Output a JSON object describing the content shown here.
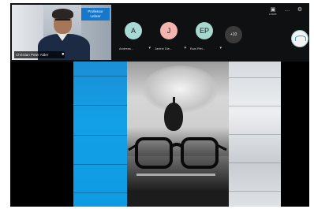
{
  "meeting": {
    "self_view": {
      "name_label": "Christian Peter Alder",
      "badge_line1": "Professor",
      "badge_line2": "Lehrer"
    },
    "participants": [
      {
        "initials": "A",
        "label": "Andreas...",
        "color": "#a9d9d4"
      },
      {
        "initials": "J",
        "label": "Janine Die...",
        "color": "#f3b4b0"
      },
      {
        "initials": "EP",
        "label": "Ewa Pitri...",
        "color": "#a6d8cf"
      }
    ],
    "more_count": "+10",
    "controls": {
      "text": "Leave"
    }
  },
  "shared_content": {
    "panels": [
      "blue-wood",
      "glasses-photo",
      "white-wood"
    ]
  }
}
